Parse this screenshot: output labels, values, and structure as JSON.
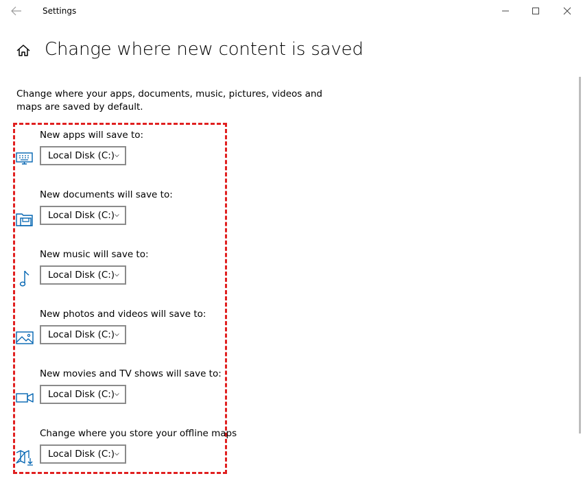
{
  "window": {
    "title": "Settings"
  },
  "page": {
    "title": "Change where new content is saved",
    "description": "Change where your apps, documents, music, pictures, videos and maps are saved by default."
  },
  "settings": [
    {
      "label": "New apps will save to:",
      "value": "Local Disk (C:)",
      "icon": "desktop-keyboard-icon"
    },
    {
      "label": "New documents will save to:",
      "value": "Local Disk (C:)",
      "icon": "documents-folder-icon"
    },
    {
      "label": "New music will save to:",
      "value": "Local Disk (C:)",
      "icon": "music-note-icon"
    },
    {
      "label": "New photos and videos will save to:",
      "value": "Local Disk (C:)",
      "icon": "photo-icon"
    },
    {
      "label": "New movies and TV shows will save to:",
      "value": "Local Disk (C:)",
      "icon": "video-camera-icon"
    },
    {
      "label": "Change where you store your offline maps",
      "value": "Local Disk (C:)",
      "icon": "map-download-icon"
    }
  ],
  "colors": {
    "accent": "#0063b1",
    "highlight_border": "#e02020",
    "dropdown_border": "#8a8a8a"
  }
}
